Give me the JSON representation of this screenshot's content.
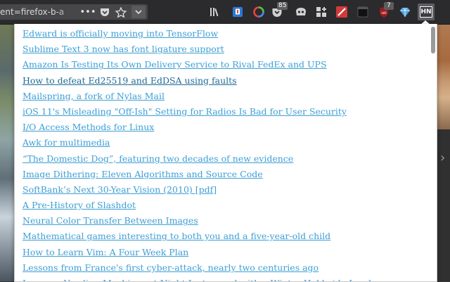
{
  "url_bar": {
    "text": "ent=firefox-b-a",
    "more_label": "•••"
  },
  "toolbar": {
    "badges": {
      "pocket_count": "85",
      "ublock_count": "7"
    },
    "hn_label": "HN"
  },
  "colors": {
    "link": "#3d9fd6",
    "link_visited": "#1e6a96",
    "toolbar_bg": "#2b2b2e"
  },
  "stories": [
    {
      "title": "Edward is officially moving into TensorFlow",
      "visited": false
    },
    {
      "title": "Sublime Text 3 now has font ligature support",
      "visited": false
    },
    {
      "title": "Amazon Is Testing Its Own Delivery Service to Rival FedEx and UPS",
      "visited": false
    },
    {
      "title": "How to defeat Ed25519 and EdDSA using faults",
      "visited": true
    },
    {
      "title": "Mailspring, a fork of Nylas Mail",
      "visited": false
    },
    {
      "title": "iOS 11's Misleading \"Off-Ish\" Setting for Radios Is Bad for User Security",
      "visited": false
    },
    {
      "title": "I/O Access Methods for Linux",
      "visited": false
    },
    {
      "title": "Awk for multimedia",
      "visited": false
    },
    {
      "title": "“The Domestic Dog”, featuring two decades of new evidence",
      "visited": false
    },
    {
      "title": "Image Dithering: Eleven Algorithms and Source Code",
      "visited": false
    },
    {
      "title": "SoftBank’s Next 30-Year Vision (2010) [pdf]",
      "visited": false
    },
    {
      "title": "A Pre-History of Slashdot",
      "visited": false
    },
    {
      "title": "Neural Color Transfer Between Images",
      "visited": false
    },
    {
      "title": "Mathematical games interesting to both you and a five-year-old child",
      "visited": false
    },
    {
      "title": "How to Learn Vim: A Four Week Plan",
      "visited": false
    },
    {
      "title": "Lessons from France's first cyber-attack, nearly two centuries ago",
      "visited": false
    },
    {
      "title": "Lessons: Vending Machines at Night Juxtaposed with a Winter Hokkaido Landscape",
      "visited": false
    }
  ]
}
